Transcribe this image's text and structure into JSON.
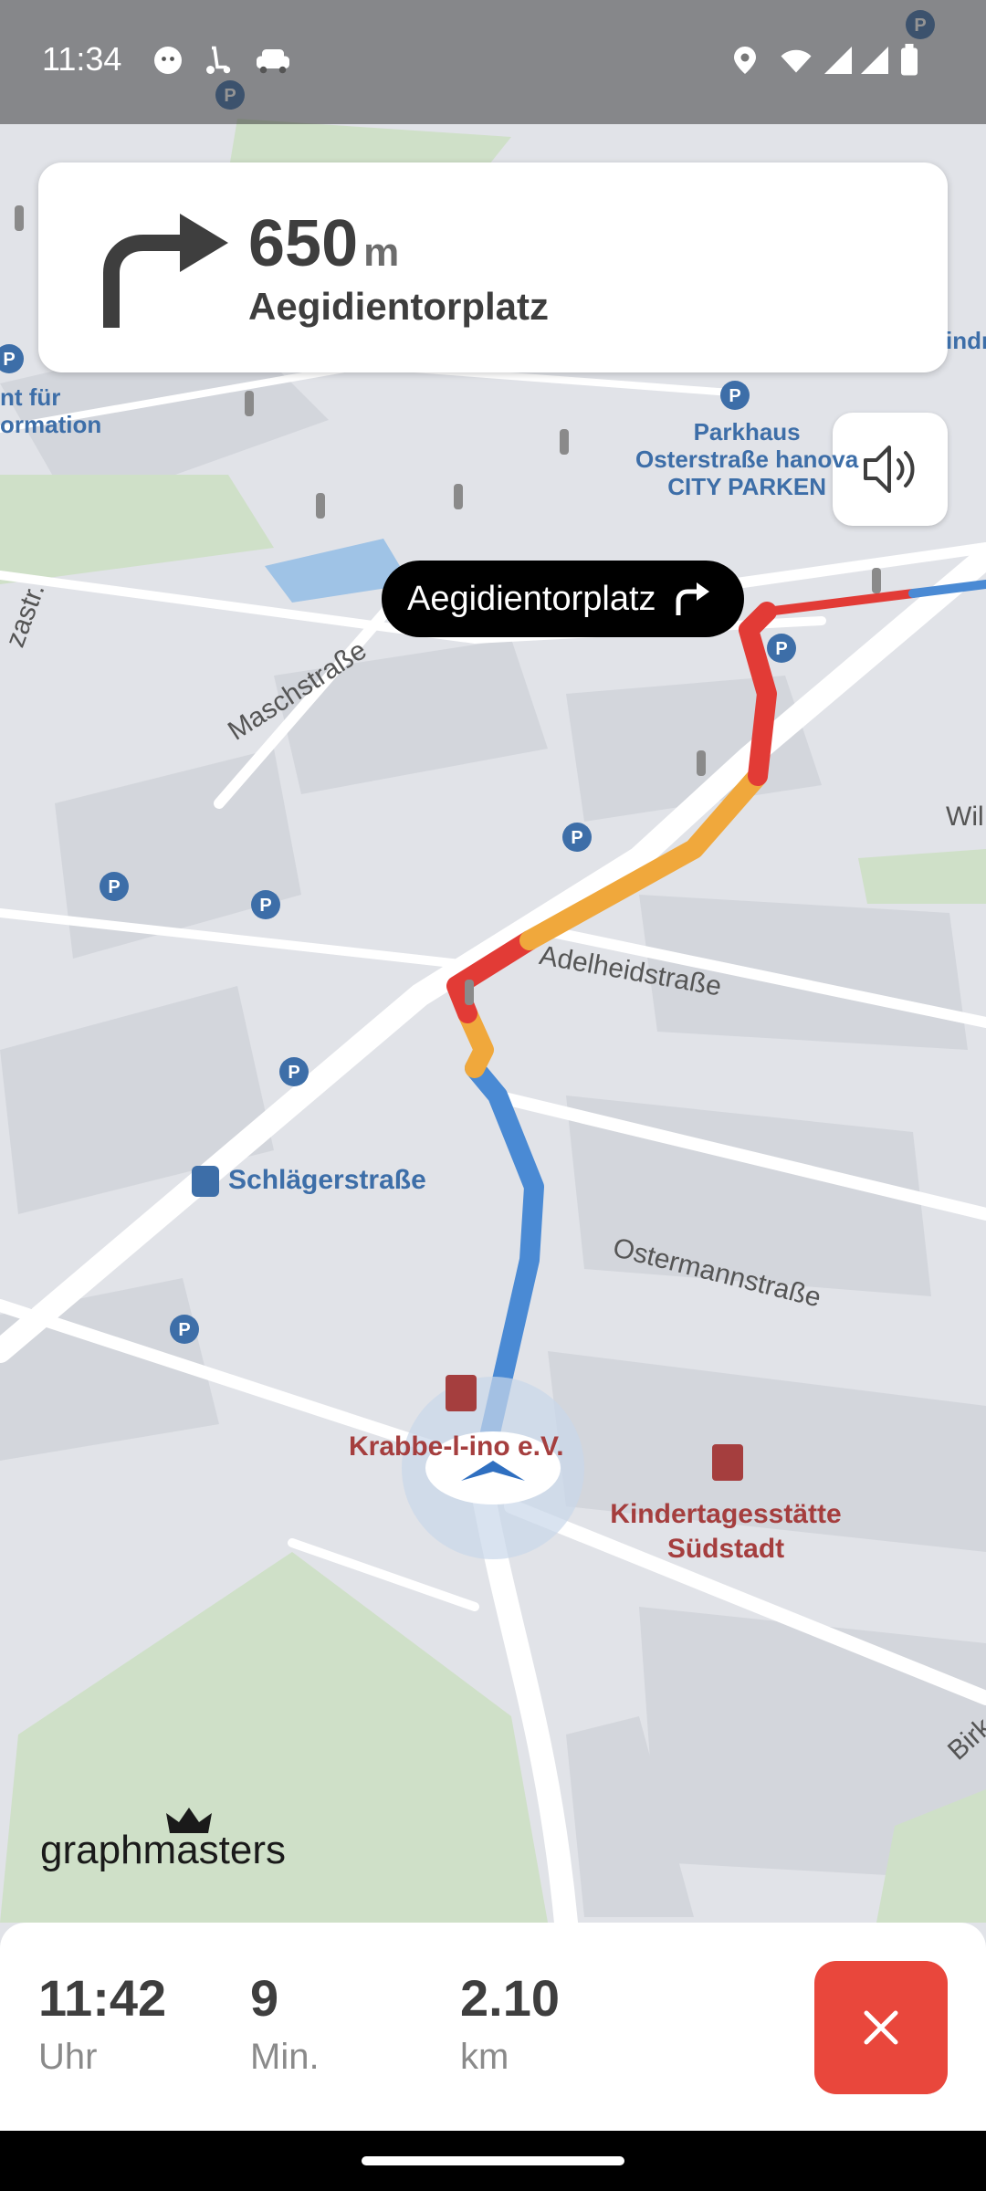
{
  "status_bar": {
    "time": "11:34",
    "left_icons": [
      "face-icon",
      "scooter-icon",
      "car-icon"
    ],
    "right_icons": [
      "location-icon",
      "wifi-icon",
      "signal-icon",
      "signal-icon",
      "battery-icon"
    ]
  },
  "maneuver": {
    "distance_value": "650",
    "distance_unit": "m",
    "street": "Aegidientorplatz",
    "icon": "turn-right-icon"
  },
  "sound_button": {
    "icon": "speaker-icon"
  },
  "next_turn_pill": {
    "label": "Aegidientorplatz",
    "icon": "turn-right-icon"
  },
  "map": {
    "pois": [
      {
        "label": "Parkhaus\nOsterstraße hanova\nCITY PARKEN"
      },
      {
        "label": "Schlägerstraße"
      },
      {
        "label": "Krabbe-l-ino e.V."
      },
      {
        "label": "Kindertagesstätte\nSüdstadt"
      },
      {
        "label": "nt für\normation"
      },
      {
        "label": "indr"
      }
    ],
    "streets": [
      "Maschstraße",
      "Adelheidstraße",
      "Ostermannstraße",
      "Wil",
      "Birk",
      "zastr."
    ],
    "colors": {
      "route_blue": "#4a8ad4",
      "route_orange": "#f0a83c",
      "route_red": "#e23b36"
    }
  },
  "logo": {
    "text": "graphmasters"
  },
  "trip_summary": {
    "arrival_time": "11:42",
    "arrival_unit": "Uhr",
    "duration": "9",
    "duration_unit": "Min.",
    "distance": "2.10",
    "distance_unit": "km",
    "close_icon": "close-icon",
    "close_color": "#e9473c"
  }
}
